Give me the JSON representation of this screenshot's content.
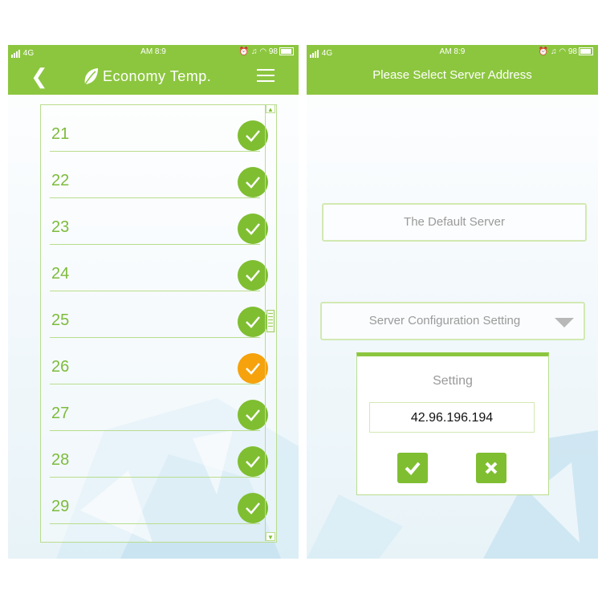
{
  "left_screen": {
    "status": {
      "network": "4G",
      "time": "AM 8:9",
      "battery": "98"
    },
    "title": "Economy Temp.",
    "back_icon": "chevron-left-icon",
    "menu_icon": "hamburger-menu-icon",
    "logo_icon": "leaf-icon",
    "list": [
      {
        "label": "21",
        "state": "checked"
      },
      {
        "label": "22",
        "state": "checked"
      },
      {
        "label": "23",
        "state": "checked"
      },
      {
        "label": "24",
        "state": "checked"
      },
      {
        "label": "25",
        "state": "checked"
      },
      {
        "label": "26",
        "state": "selected"
      },
      {
        "label": "27",
        "state": "checked"
      },
      {
        "label": "28",
        "state": "checked"
      },
      {
        "label": "29",
        "state": "checked"
      }
    ],
    "colors": {
      "checked": "#7fbe31",
      "selected": "#f5a20d"
    }
  },
  "right_screen": {
    "status": {
      "network": "4G",
      "time": "AM 8:9",
      "battery": "98"
    },
    "title": "Please Select Server Address",
    "default_server_label": "The Default Server",
    "server_config_label": "Server Configuration Setting",
    "dialog": {
      "title": "Setting",
      "input_value": "42.96.196.194",
      "confirm_icon": "check-icon",
      "cancel_icon": "close-icon"
    }
  },
  "theme": {
    "accent": "#8cc63f"
  }
}
